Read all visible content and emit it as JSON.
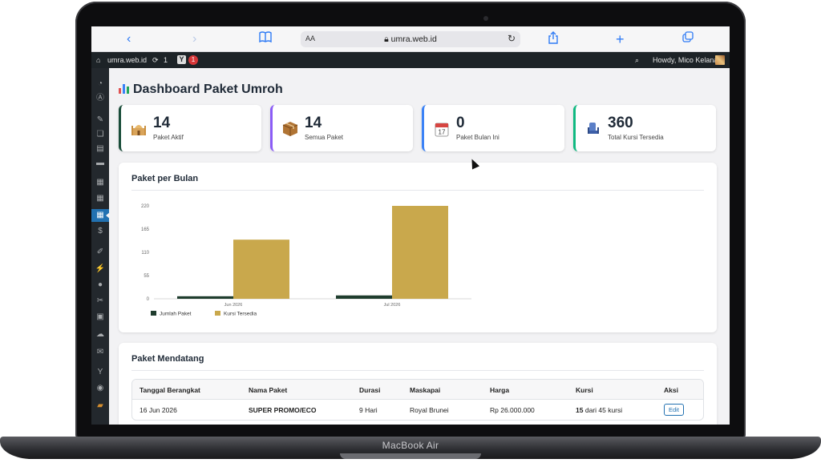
{
  "device": {
    "label": "MacBook Air"
  },
  "browser": {
    "text_size_label": "AA",
    "url": "umra.web.id"
  },
  "admin_bar": {
    "site_name": "umra.web.id",
    "updates_count": "1",
    "notification_count": "1",
    "greeting": "Howdy, Mico Kelana"
  },
  "page": {
    "title": "Dashboard Paket Umroh"
  },
  "stats": [
    {
      "value": "14",
      "label": "Paket Aktif",
      "accent": "#1a4d3a",
      "icon": "mosque-icon"
    },
    {
      "value": "14",
      "label": "Semua Paket",
      "accent": "#8b5cf6",
      "icon": "package-icon"
    },
    {
      "value": "0",
      "label": "Paket Bulan Ini",
      "accent": "#3b82f6",
      "icon": "calendar-icon"
    },
    {
      "value": "360",
      "label": "Total Kursi Tersedia",
      "accent": "#10b981",
      "icon": "seat-icon"
    }
  ],
  "chart_panel": {
    "title": "Paket per Bulan"
  },
  "chart_data": {
    "type": "bar",
    "categories": [
      "Jun 2026",
      "Jul 2026"
    ],
    "series": [
      {
        "name": "Jumlah Paket",
        "values": [
          6,
          8
        ],
        "color": "#1f3d2e"
      },
      {
        "name": "Kursi Tersedia",
        "values": [
          140,
          220
        ],
        "color": "#c9a84c"
      }
    ],
    "yticks": [
      0,
      55,
      110,
      165,
      220
    ],
    "ylim": [
      0,
      220
    ],
    "legend_position": "bottom-left",
    "grid": false
  },
  "upcoming": {
    "title": "Paket Mendatang",
    "headers": [
      "Tanggal Berangkat",
      "Nama Paket",
      "Durasi",
      "Maskapai",
      "Harga",
      "Kursi",
      "Aksi"
    ],
    "rows": [
      {
        "date": "16 Jun 2026",
        "name": "SUPER PROMO/ECO",
        "duration": "9 Hari",
        "airline": "Royal Brunei",
        "price": "Rp 26.000.000",
        "seats_available": "15",
        "seats_rest": "dari 45 kursi",
        "action": "Edit"
      }
    ]
  },
  "colors": {
    "admin_bar": "#1d2327",
    "sidebar": "#23282d",
    "active_menu": "#2271b1",
    "safari_blue": "#2f7bf5"
  }
}
